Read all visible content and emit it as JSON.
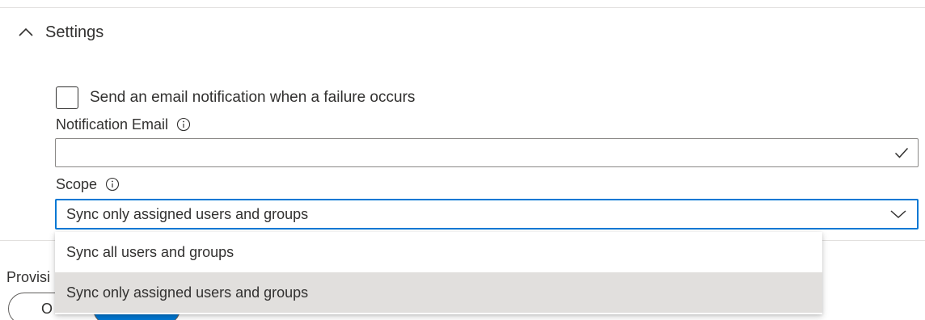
{
  "settings": {
    "title": "Settings",
    "expanded": true
  },
  "notification": {
    "checkbox_label": "Send an email notification when a failure occurs",
    "checked": false,
    "email_label": "Notification Email",
    "email_value": "",
    "email_placeholder": ""
  },
  "scope": {
    "label": "Scope",
    "selected": "Sync only assigned users and groups",
    "options": [
      {
        "label": "Sync all users and groups",
        "selected": false
      },
      {
        "label": "Sync only assigned users and groups",
        "selected": true
      }
    ]
  },
  "provisioning": {
    "label_partial": "Provisi",
    "toggle_label_partial": "O"
  },
  "colors": {
    "accent": "#0078d4",
    "text": "#323130",
    "border": "#8a8886",
    "selected_option_bg": "#e1dfdd"
  },
  "icons": {
    "collapse": "chevron-up-icon",
    "info": "info-icon",
    "valid": "checkmark-icon",
    "dropdown": "chevron-down-icon"
  }
}
